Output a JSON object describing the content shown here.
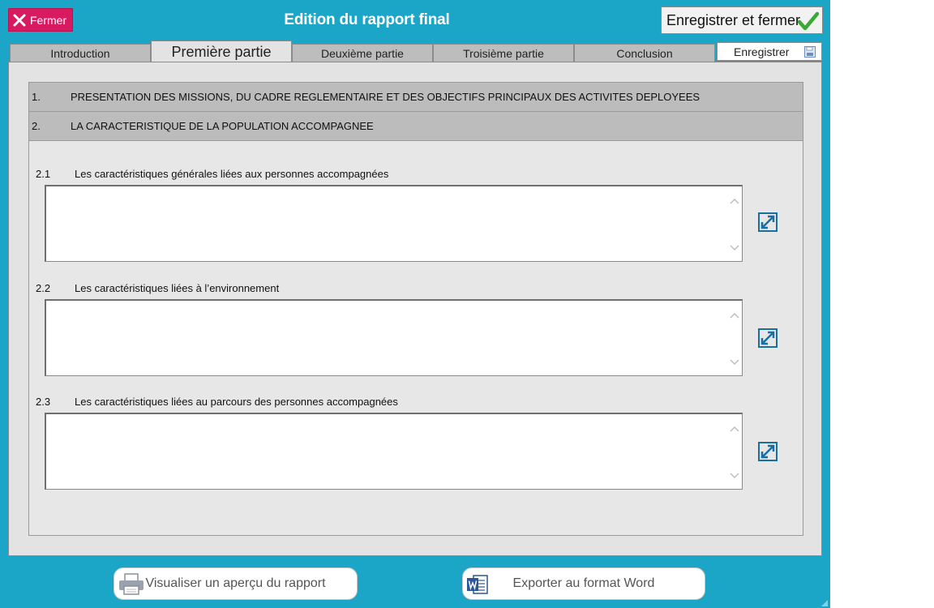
{
  "window": {
    "title": "Edition du rapport final",
    "close_label": "Fermer",
    "save_close_label": "Enregistrer et fermer"
  },
  "tabs": [
    {
      "label": "Introduction",
      "active": false
    },
    {
      "label": "Première partie",
      "active": true
    },
    {
      "label": "Deuxième partie",
      "active": false
    },
    {
      "label": "Troisième partie",
      "active": false
    },
    {
      "label": "Conclusion",
      "active": false
    },
    {
      "label": "Enregistrer",
      "active": false
    }
  ],
  "sections": [
    {
      "number": "1.",
      "title": "PRESENTATION DES MISSIONS, DU CADRE REGLEMENTAIRE ET DES OBJECTIFS PRINCIPAUX DES ACTIVITES DEPLOYEES"
    },
    {
      "number": "2.",
      "title": "LA CARACTERISTIQUE DE LA POPULATION ACCOMPAGNEE"
    }
  ],
  "subsections": [
    {
      "number": "2.1",
      "label": "Les caractéristiques générales liées aux personnes accompagnées",
      "value": ""
    },
    {
      "number": "2.2",
      "label": "Les caractéristiques liées à l’environnement",
      "value": ""
    },
    {
      "number": "2.3",
      "label": "Les caractéristiques liées au parcours des personnes accompagnées",
      "value": ""
    }
  ],
  "footer": {
    "preview_label": "Visualiser un aperçu du rapport",
    "export_label": "Exporter au format Word"
  },
  "colors": {
    "background": "#1ba6c7",
    "close_button": "#d81b60",
    "check": "#3aa935",
    "expand_icon": "#1a6fa0",
    "word_blue": "#2b5797"
  },
  "icons": {
    "close": "close-icon",
    "save_close": "check-icon",
    "save_tab": "save-disk-icon",
    "expand": "expand-icon",
    "print": "printer-icon",
    "word": "word-icon"
  }
}
